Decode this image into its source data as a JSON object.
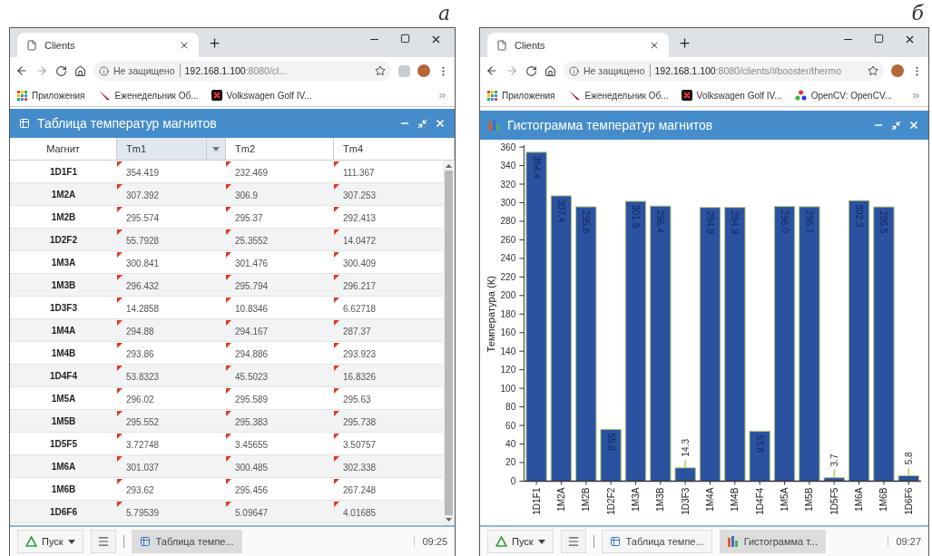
{
  "panels": [
    {
      "label": "а",
      "browser": {
        "tab_title": "Clients",
        "security": "Не защищено",
        "url_host": "192.168.1.100",
        "url_rest": ":8080/cl...",
        "extension": true,
        "bookmarks": [
          {
            "kind": "apps",
            "label": "Приложения"
          },
          {
            "kind": "diary",
            "label": "Еженедельник Об..."
          },
          {
            "kind": "vw",
            "label": "Volkswagen Golf IV..."
          }
        ]
      },
      "app": {
        "kind": "table",
        "title": "Таблица температур магнитов",
        "table": {
          "columns": [
            {
              "label": "Магнит",
              "selected": false
            },
            {
              "label": "Tm1",
              "selected": true
            },
            {
              "label": "Tm2",
              "selected": false
            },
            {
              "label": "Tm4",
              "selected": false
            }
          ],
          "rows": [
            {
              "name": "1D1F1",
              "values": [
                "354.419",
                "232.469",
                "111.367"
              ]
            },
            {
              "name": "1M2A",
              "values": [
                "307.392",
                "306.9",
                "307.253"
              ]
            },
            {
              "name": "1M2B",
              "values": [
                "295.574",
                "295.37",
                "292.413"
              ]
            },
            {
              "name": "1D2F2",
              "values": [
                "55.7928",
                "25.3552",
                "14.0472"
              ]
            },
            {
              "name": "1M3A",
              "values": [
                "300.841",
                "301.476",
                "300.409"
              ]
            },
            {
              "name": "1M3B",
              "values": [
                "296.432",
                "295.794",
                "296.217"
              ]
            },
            {
              "name": "1D3F3",
              "values": [
                "14.2858",
                "10.8346",
                "6.62718"
              ]
            },
            {
              "name": "1M4A",
              "values": [
                "294.88",
                "294.167",
                "287.37"
              ]
            },
            {
              "name": "1M4B",
              "values": [
                "293.86",
                "294.886",
                "293.923"
              ]
            },
            {
              "name": "1D4F4",
              "values": [
                "53.8323",
                "45.5023",
                "16.8326"
              ]
            },
            {
              "name": "1M5A",
              "values": [
                "296.02",
                "295.589",
                "295.63"
              ]
            },
            {
              "name": "1M5B",
              "values": [
                "295.552",
                "295.383",
                "295.738"
              ]
            },
            {
              "name": "1D5F5",
              "values": [
                "3.72748",
                "3.45655",
                "3.50757"
              ]
            },
            {
              "name": "1M6A",
              "values": [
                "301.037",
                "300.485",
                "302.338"
              ]
            },
            {
              "name": "1M6B",
              "values": [
                "293.62",
                "295.456",
                "267.248"
              ]
            },
            {
              "name": "1D6F6",
              "values": [
                "5.79539",
                "5.09647",
                "4.01685"
              ]
            }
          ]
        }
      },
      "taskbar": {
        "start": "Пуск",
        "tasks": [
          {
            "kind": "table",
            "label": "Таблица темпе...",
            "selected": true
          }
        ],
        "clock": "09:25"
      }
    },
    {
      "label": "б",
      "browser": {
        "tab_title": "Clients",
        "security": "Не защищено",
        "url_host": "192.168.1.100",
        "url_rest": ":8080/clients/#booster/thermo",
        "extension": false,
        "bookmarks": [
          {
            "kind": "apps",
            "label": "Приложения"
          },
          {
            "kind": "diary",
            "label": "Еженедельник Об..."
          },
          {
            "kind": "vw",
            "label": "Volkswagen Golf IV..."
          },
          {
            "kind": "opencv",
            "label": "OpenCV: OpenCV..."
          }
        ]
      },
      "app": {
        "kind": "chart",
        "title": "Гистограмма температур магнитов",
        "chart_data": {
          "type": "bar",
          "ylabel": "Температура (К)",
          "categories": [
            "1D1F1",
            "1M2A",
            "1M2B",
            "1D2F2",
            "1M3A",
            "1M3B",
            "1D3F3",
            "1M4A",
            "1M4B",
            "1D4F4",
            "1M5A",
            "1M5B",
            "1D5F5",
            "1M6A",
            "1M6B",
            "1D6F6"
          ],
          "values": [
            354.4,
            307.4,
            295.6,
            55.8,
            301.5,
            296.4,
            14.3,
            294.9,
            294.9,
            53.8,
            296.0,
            295.7,
            3.7,
            302.3,
            295.5,
            5.8
          ],
          "value_labels": [
            "354.4",
            "307.4",
            "295.6",
            "55.8",
            "301.5",
            "296.4",
            "14.3",
            "294.9",
            "294.9",
            "53.8",
            "296.0",
            "295.7",
            "3.7",
            "302.3",
            "295.5",
            "5.8"
          ],
          "ylim": [
            0,
            360
          ],
          "yticks": [
            0,
            20,
            40,
            60,
            80,
            100,
            120,
            140,
            160,
            180,
            200,
            220,
            240,
            260,
            280,
            300,
            320,
            340,
            360
          ]
        }
      },
      "taskbar": {
        "start": "Пуск",
        "tasks": [
          {
            "kind": "table",
            "label": "Таблица темпе...",
            "selected": false
          },
          {
            "kind": "chart",
            "label": "Гистограмма т...",
            "selected": true
          }
        ],
        "clock": "09:27"
      }
    }
  ]
}
